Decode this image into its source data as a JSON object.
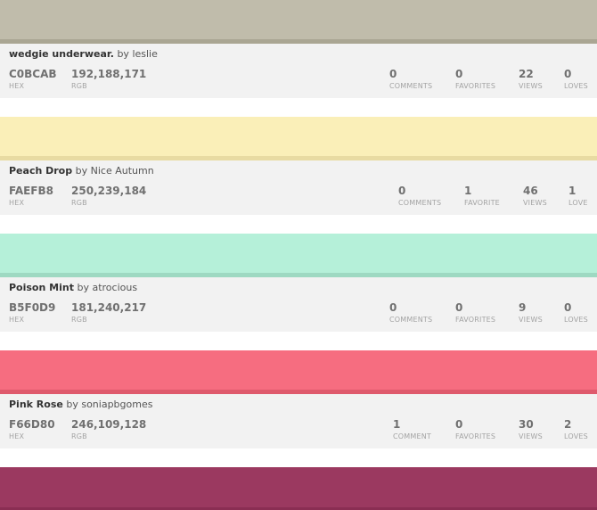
{
  "colors": [
    {
      "title": "wedgie underwear.",
      "by": "by",
      "author": "leslie",
      "hex": "C0BCAB",
      "rgb": "192,188,171",
      "hex_label": "HEX",
      "rgb_label": "RGB",
      "comments": "0",
      "comments_label": "COMMENTS",
      "favorites": "0",
      "favorites_label": "FAVORITES",
      "views": "22",
      "views_label": "VIEWS",
      "loves": "0",
      "loves_label": "LOVES",
      "swatch_color": "#C0BCAB"
    },
    {
      "title": "Peach Drop",
      "by": "by",
      "author": "Nice Autumn",
      "hex": "FAEFB8",
      "rgb": "250,239,184",
      "hex_label": "HEX",
      "rgb_label": "RGB",
      "comments": "0",
      "comments_label": "COMMENTS",
      "favorites": "1",
      "favorites_label": "FAVORITE",
      "views": "46",
      "views_label": "VIEWS",
      "loves": "1",
      "loves_label": "LOVE",
      "swatch_color": "#FAEFB8"
    },
    {
      "title": "Poison Mint",
      "by": "by",
      "author": "atrocious",
      "hex": "B5F0D9",
      "rgb": "181,240,217",
      "hex_label": "HEX",
      "rgb_label": "RGB",
      "comments": "0",
      "comments_label": "COMMENTS",
      "favorites": "0",
      "favorites_label": "FAVORITES",
      "views": "9",
      "views_label": "VIEWS",
      "loves": "0",
      "loves_label": "LOVES",
      "swatch_color": "#B5F0D9"
    },
    {
      "title": "Pink Rose",
      "by": "by",
      "author": "soniapbgomes",
      "hex": "F66D80",
      "rgb": "246,109,128",
      "hex_label": "HEX",
      "rgb_label": "RGB",
      "comments": "1",
      "comments_label": "COMMENT",
      "favorites": "0",
      "favorites_label": "FAVORITES",
      "views": "30",
      "views_label": "VIEWS",
      "loves": "2",
      "loves_label": "LOVES",
      "swatch_color": "#F66D80"
    }
  ],
  "partial_swatch_color": "#9B3960"
}
